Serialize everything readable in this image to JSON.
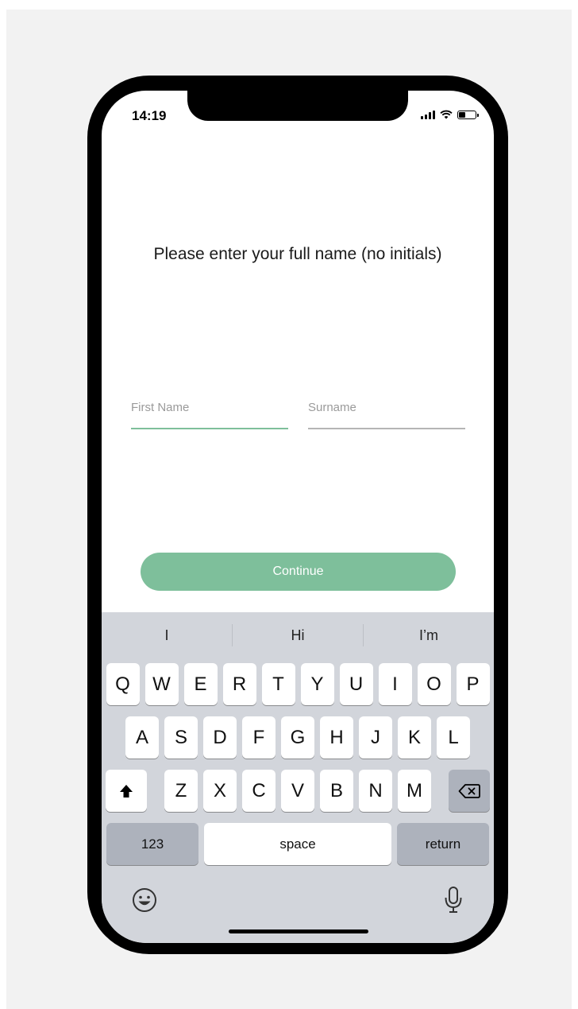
{
  "status_bar": {
    "time": "14:19"
  },
  "prompt": {
    "title": "Please enter your full name (no initials)"
  },
  "form": {
    "first_name": {
      "value": "",
      "placeholder": "First Name"
    },
    "surname": {
      "value": "",
      "placeholder": "Surname"
    },
    "continue_label": "Continue"
  },
  "keyboard": {
    "suggestions": [
      "I",
      "Hi",
      "I’m"
    ],
    "row1": [
      "Q",
      "W",
      "E",
      "R",
      "T",
      "Y",
      "U",
      "I",
      "O",
      "P"
    ],
    "row2": [
      "A",
      "S",
      "D",
      "F",
      "G",
      "H",
      "J",
      "K",
      "L"
    ],
    "row3": [
      "Z",
      "X",
      "C",
      "V",
      "B",
      "N",
      "M"
    ],
    "numbers_label": "123",
    "space_label": "space",
    "return_label": "return"
  },
  "colors": {
    "accent": "#7ebf9b",
    "keyboard_bg": "#d2d5db"
  }
}
